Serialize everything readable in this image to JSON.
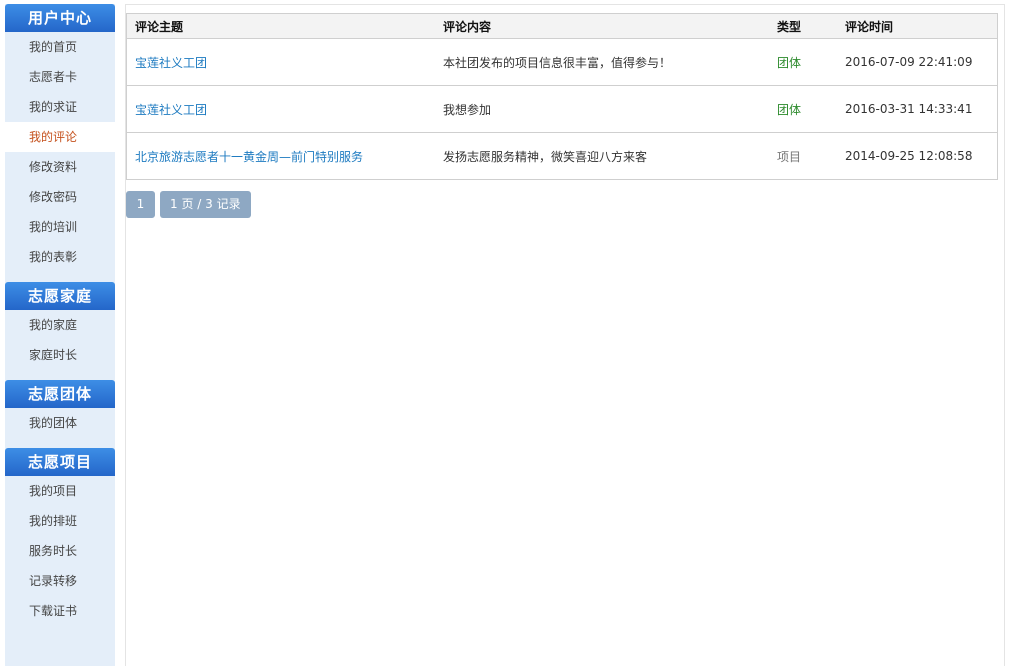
{
  "sidebar": {
    "sections": [
      {
        "title": "用户中心",
        "items": [
          "我的首页",
          "志愿者卡",
          "我的求证",
          "我的评论",
          "修改资料",
          "修改密码",
          "我的培训",
          "我的表彰"
        ]
      },
      {
        "title": "志愿家庭",
        "items": [
          "我的家庭",
          "家庭时长"
        ]
      },
      {
        "title": "志愿团体",
        "items": [
          "我的团体"
        ]
      },
      {
        "title": "志愿项目",
        "items": [
          "我的项目",
          "我的排班",
          "服务时长",
          "记录转移",
          "下载证书"
        ]
      }
    ]
  },
  "table": {
    "headers": {
      "topic": "评论主题",
      "content": "评论内容",
      "type": "类型",
      "time": "评论时间"
    },
    "rows": [
      {
        "topic": "宝莲社义工团",
        "content": "本社团发布的项目信息很丰富，值得参与！",
        "type": "团体",
        "time": "2016-07-09 22:41:09"
      },
      {
        "topic": "宝莲社义工团",
        "content": "我想参加",
        "type": "团体",
        "time": "2016-03-31 14:33:41"
      },
      {
        "topic": "北京旅游志愿者十一黄金周—前门特别服务",
        "content": "发扬志愿服务精神，微笑喜迎八方来客",
        "type": "项目",
        "time": "2014-09-25 12:08:58"
      }
    ]
  },
  "pager": {
    "current_page": "1",
    "summary": "1 页 / 3 记录"
  },
  "colors": {
    "sidebar_bg": "#e4eef9",
    "section_header": "#2f78d8",
    "active_text": "#c5521e",
    "link": "#1c7ac0",
    "type_team": "#2c8a2c",
    "type_project": "#777777",
    "pager_bg": "#8ea8c3"
  }
}
